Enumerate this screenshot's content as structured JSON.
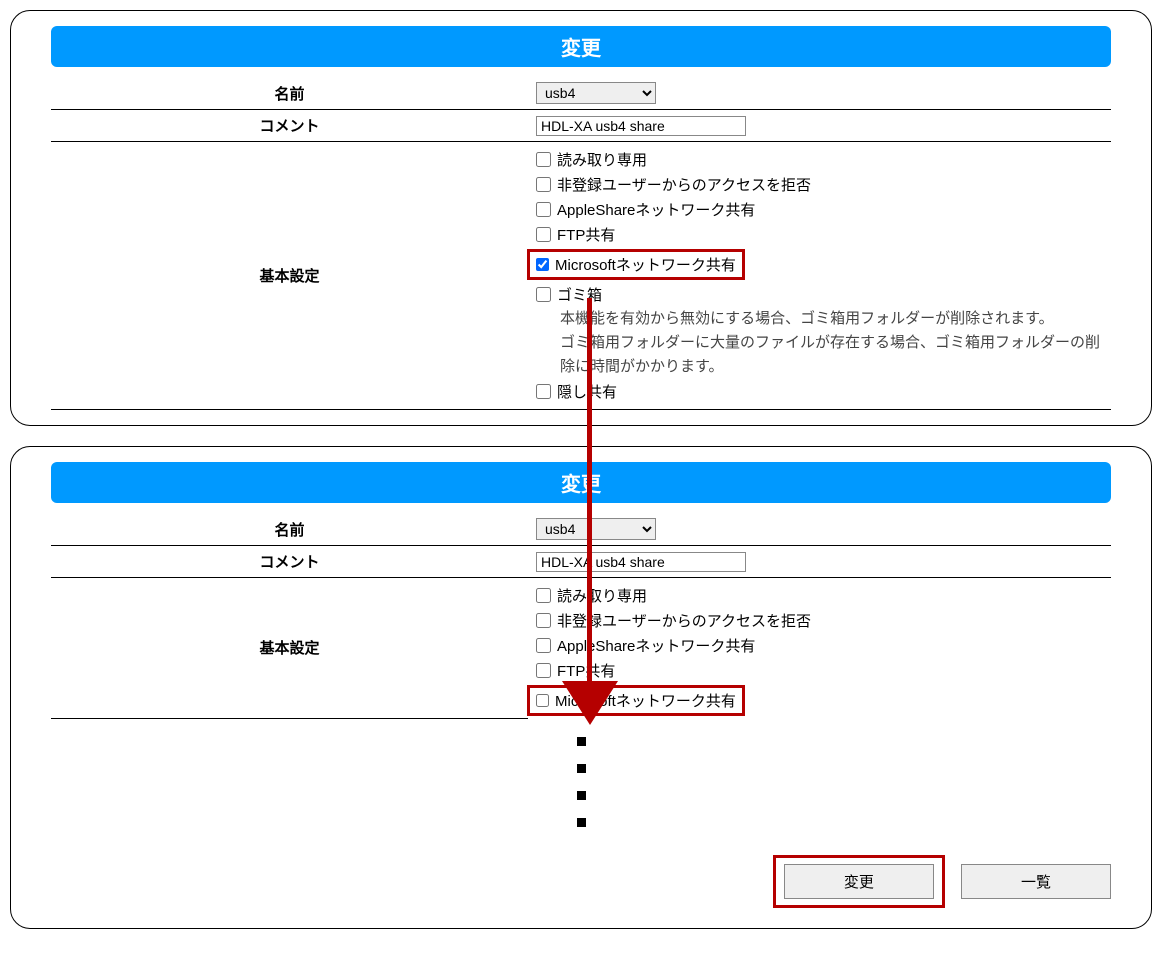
{
  "panel1": {
    "title": "変更",
    "rows": {
      "name": {
        "label": "名前",
        "value": "usb4"
      },
      "comment": {
        "label": "コメント",
        "value": "HDL-XA usb4 share"
      },
      "basic": {
        "label": "基本設定",
        "options": {
          "readonly": "読み取り専用",
          "deny_unregistered": "非登録ユーザーからのアクセスを拒否",
          "appleshare": "AppleShareネットワーク共有",
          "ftp": "FTP共有",
          "msnet": "Microsoftネットワーク共有",
          "trash": "ゴミ箱",
          "trash_note": "本機能を有効から無効にする場合、ゴミ箱用フォルダーが削除されます。\nゴミ箱用フォルダーに大量のファイルが存在する場合、ゴミ箱用フォルダーの削除に時間がかかります。",
          "hidden": "隠し共有"
        }
      }
    }
  },
  "panel2": {
    "title": "変更",
    "rows": {
      "name": {
        "label": "名前",
        "value": "usb4"
      },
      "comment": {
        "label": "コメント",
        "value": "HDL-XA usb4 share"
      },
      "basic": {
        "label": "基本設定",
        "options": {
          "readonly": "読み取り専用",
          "deny_unregistered": "非登録ユーザーからのアクセスを拒否",
          "appleshare": "AppleShareネットワーク共有",
          "ftp": "FTP共有",
          "msnet": "Microsoftネットワーク共有"
        }
      }
    }
  },
  "buttons": {
    "change": "変更",
    "list": "一覧"
  }
}
